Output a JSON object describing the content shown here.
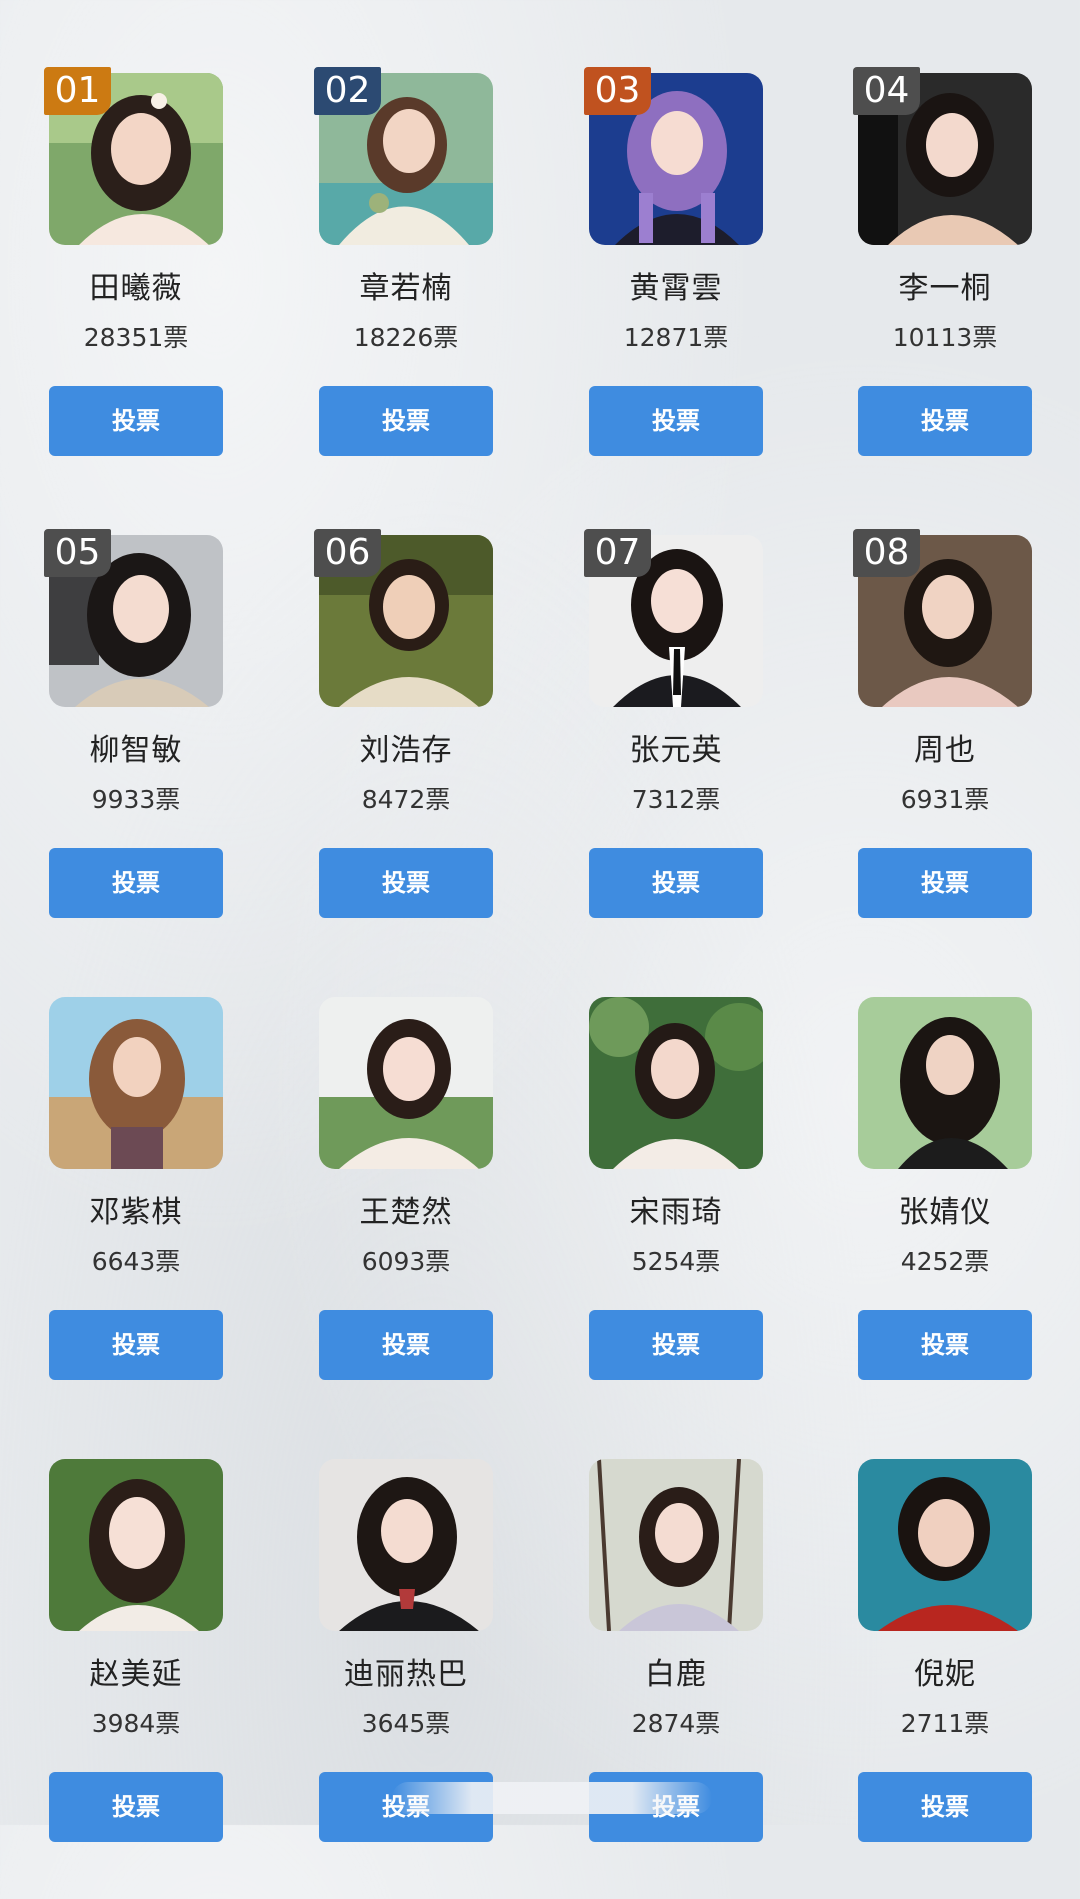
{
  "vote_label": "投票",
  "colors": {
    "button": "#3f8ce0",
    "rank_gold": "#cc7a12",
    "rank_blue": "#2c4a72",
    "rank_red": "#c0521f",
    "rank_gray": "#4e4e4e"
  },
  "candidates": [
    {
      "rank": "01",
      "rank_color": "#cc7a12",
      "name": "田曦薇",
      "votes": "28351票"
    },
    {
      "rank": "02",
      "rank_color": "#2c4a72",
      "name": "章若楠",
      "votes": "18226票"
    },
    {
      "rank": "03",
      "rank_color": "#c0521f",
      "name": "黄霄雲",
      "votes": "12871票"
    },
    {
      "rank": "04",
      "rank_color": "#4e4e4e",
      "name": "李一桐",
      "votes": "10113票"
    },
    {
      "rank": "05",
      "rank_color": "#4e4e4e",
      "name": "柳智敏",
      "votes": "9933票"
    },
    {
      "rank": "06",
      "rank_color": "#4e4e4e",
      "name": "刘浩存",
      "votes": "8472票"
    },
    {
      "rank": "07",
      "rank_color": "#4e4e4e",
      "name": "张元英",
      "votes": "7312票"
    },
    {
      "rank": "08",
      "rank_color": "#4e4e4e",
      "name": "周也",
      "votes": "6931票"
    },
    {
      "rank": "",
      "rank_color": "",
      "name": "邓紫棋",
      "votes": "6643票"
    },
    {
      "rank": "",
      "rank_color": "",
      "name": "王楚然",
      "votes": "6093票"
    },
    {
      "rank": "",
      "rank_color": "",
      "name": "宋雨琦",
      "votes": "5254票"
    },
    {
      "rank": "",
      "rank_color": "",
      "name": "张婧仪",
      "votes": "4252票"
    },
    {
      "rank": "",
      "rank_color": "",
      "name": "赵美延",
      "votes": "3984票"
    },
    {
      "rank": "",
      "rank_color": "",
      "name": "迪丽热巴",
      "votes": "3645票"
    },
    {
      "rank": "",
      "rank_color": "",
      "name": "白鹿",
      "votes": "2874票"
    },
    {
      "rank": "",
      "rank_color": "",
      "name": "倪妮",
      "votes": "2711票"
    }
  ]
}
